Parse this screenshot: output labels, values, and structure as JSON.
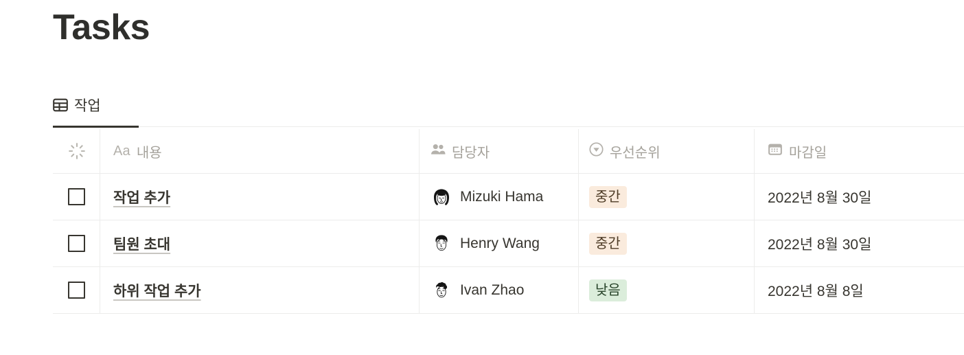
{
  "page": {
    "title": "Tasks"
  },
  "tabs": [
    {
      "label": "작업",
      "icon": "table-grid-icon",
      "active": true
    }
  ],
  "table": {
    "columns": [
      {
        "key": "check",
        "label": "",
        "icon": "spinner-icon"
      },
      {
        "key": "name",
        "label": "내용",
        "icon": "text-aa-icon",
        "prefix": "Aa"
      },
      {
        "key": "assignee",
        "label": "담당자",
        "icon": "people-icon"
      },
      {
        "key": "priority",
        "label": "우선순위",
        "icon": "select-chevron-circle-icon"
      },
      {
        "key": "date",
        "label": "마감일",
        "icon": "calendar-icon"
      }
    ],
    "rows": [
      {
        "checked": false,
        "name": "작업 추가",
        "assignee": "Mizuki Hama",
        "avatar": "avatar-mizuki",
        "priority": "중간",
        "priority_level": "medium",
        "date": "2022년 8월 30일"
      },
      {
        "checked": false,
        "name": "팀원 초대",
        "assignee": "Henry Wang",
        "avatar": "avatar-henry",
        "priority": "중간",
        "priority_level": "medium",
        "date": "2022년 8월 30일"
      },
      {
        "checked": false,
        "name": "하위 작업 추가",
        "assignee": "Ivan Zhao",
        "avatar": "avatar-ivan",
        "priority": "낮음",
        "priority_level": "low",
        "date": "2022년 8월 8일"
      }
    ]
  },
  "colors": {
    "text": "#37352f",
    "muted": "#a5a29b",
    "border": "#ececeb",
    "pill_medium_bg": "#faebdd",
    "pill_medium_fg": "#4d3b25",
    "pill_low_bg": "#dbeddb",
    "pill_low_fg": "#28442a",
    "accent_underline": "#37352f"
  }
}
